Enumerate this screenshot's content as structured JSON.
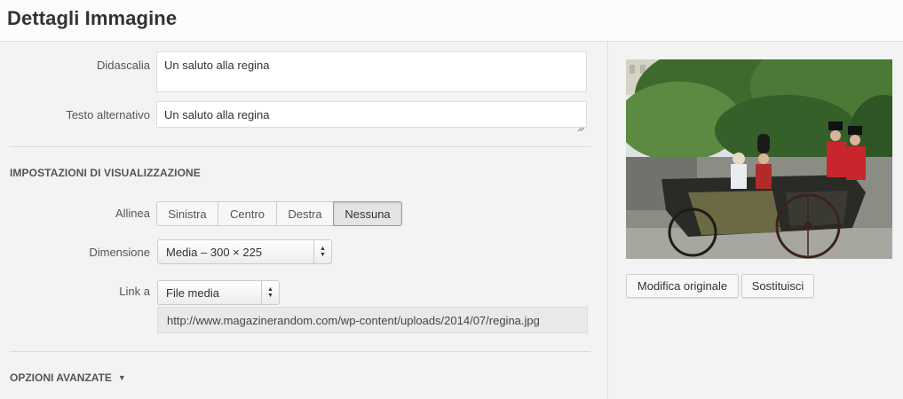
{
  "header": {
    "title": "Dettagli Immagine"
  },
  "caption": {
    "label": "Didascalia",
    "value": "Un saluto alla regina"
  },
  "alt_text": {
    "label": "Testo alternativo",
    "value": "Un saluto alla regina"
  },
  "display_settings": {
    "title": "IMPOSTAZIONI DI VISUALIZZAZIONE",
    "align": {
      "label": "Allinea",
      "options": [
        "Sinistra",
        "Centro",
        "Destra",
        "Nessuna"
      ],
      "selected": "Nessuna"
    },
    "size": {
      "label": "Dimensione",
      "value": "Media – 300 × 225"
    },
    "link": {
      "label": "Link a",
      "value": "File media",
      "url": "http://www.magazinerandom.com/wp-content/uploads/2014/07/regina.jpg"
    }
  },
  "advanced": {
    "label": "OPZIONI AVANZATE",
    "icon": "triangle-down-icon"
  },
  "preview": {
    "edit_label": "Modifica originale",
    "replace_label": "Sostituisci"
  },
  "colors": {
    "panel_bg": "#f3f3f3",
    "header_bg": "#fcfcfc",
    "border": "#dddddd",
    "url_bg": "#e9e9e9"
  }
}
